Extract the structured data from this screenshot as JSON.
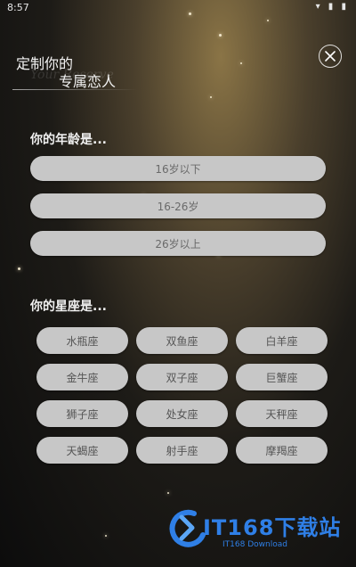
{
  "status_bar": {
    "time": "8:57",
    "icons": "▾ ▮ ▮"
  },
  "header": {
    "title_line1": "定制你的",
    "title_line2": "专属恋人",
    "decorative_text": "Your Reserve"
  },
  "age_section": {
    "title": "你的年龄是...",
    "options": [
      "16岁以下",
      "16-26岁",
      "26岁以上"
    ]
  },
  "zodiac_section": {
    "title": "你的星座是...",
    "options": [
      "水瓶座",
      "双鱼座",
      "白羊座",
      "金牛座",
      "双子座",
      "巨蟹座",
      "狮子座",
      "处女座",
      "天秤座",
      "天蝎座",
      "射手座",
      "摩羯座"
    ]
  },
  "watermark": {
    "text": "IT168下载站",
    "sub": "IT168 Download"
  },
  "colors": {
    "button_bg": "#c7c7c7",
    "watermark_blue": "#2f7fe6"
  }
}
